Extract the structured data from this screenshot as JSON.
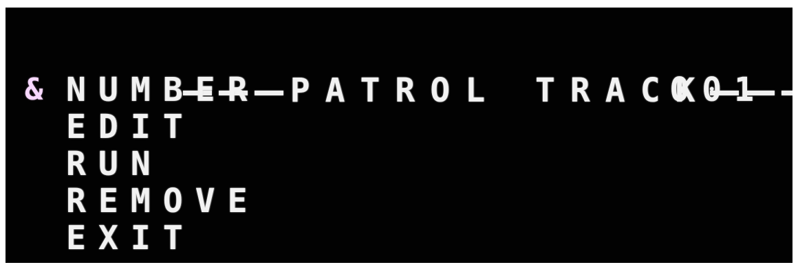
{
  "osd": {
    "title": "PATROL TRACK",
    "cursor_symbol": "&",
    "menu": [
      {
        "label": "NUMBER",
        "value": "001"
      },
      {
        "label": "EDIT"
      },
      {
        "label": "RUN"
      },
      {
        "label": "REMOVE"
      },
      {
        "label": "EXIT"
      }
    ],
    "colors": {
      "background": "#020202",
      "text": "#f2f2f2",
      "cursor": "#f7d8ff"
    }
  }
}
